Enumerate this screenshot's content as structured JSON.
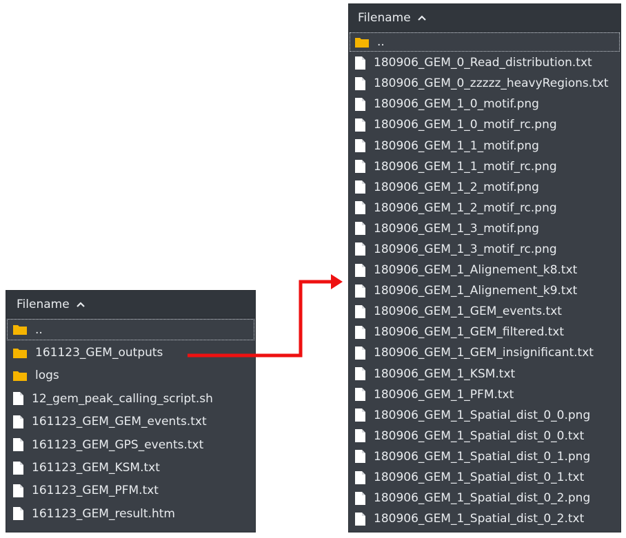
{
  "left_panel": {
    "header": {
      "label": "Filename"
    },
    "rows": [
      {
        "label": "..",
        "kind": "folder",
        "selected": true
      },
      {
        "label": "161123_GEM_outputs",
        "kind": "folder"
      },
      {
        "label": "logs",
        "kind": "folder"
      },
      {
        "label": "12_gem_peak_calling_script.sh",
        "kind": "file"
      },
      {
        "label": "161123_GEM_GEM_events.txt",
        "kind": "file"
      },
      {
        "label": "161123_GEM_GPS_events.txt",
        "kind": "file"
      },
      {
        "label": "161123_GEM_KSM.txt",
        "kind": "file"
      },
      {
        "label": "161123_GEM_PFM.txt",
        "kind": "file"
      },
      {
        "label": "161123_GEM_result.htm",
        "kind": "file"
      }
    ]
  },
  "right_panel": {
    "header": {
      "label": "Filename"
    },
    "rows": [
      {
        "label": "..",
        "kind": "folder",
        "selected": true
      },
      {
        "label": "180906_GEM_0_Read_distribution.txt",
        "kind": "file"
      },
      {
        "label": "180906_GEM_0_zzzzz_heavyRegions.txt",
        "kind": "file"
      },
      {
        "label": "180906_GEM_1_0_motif.png",
        "kind": "file"
      },
      {
        "label": "180906_GEM_1_0_motif_rc.png",
        "kind": "file"
      },
      {
        "label": "180906_GEM_1_1_motif.png",
        "kind": "file"
      },
      {
        "label": "180906_GEM_1_1_motif_rc.png",
        "kind": "file"
      },
      {
        "label": "180906_GEM_1_2_motif.png",
        "kind": "file"
      },
      {
        "label": "180906_GEM_1_2_motif_rc.png",
        "kind": "file"
      },
      {
        "label": "180906_GEM_1_3_motif.png",
        "kind": "file"
      },
      {
        "label": "180906_GEM_1_3_motif_rc.png",
        "kind": "file"
      },
      {
        "label": "180906_GEM_1_Alignement_k8.txt",
        "kind": "file"
      },
      {
        "label": "180906_GEM_1_Alignement_k9.txt",
        "kind": "file"
      },
      {
        "label": "180906_GEM_1_GEM_events.txt",
        "kind": "file"
      },
      {
        "label": "180906_GEM_1_GEM_filtered.txt",
        "kind": "file"
      },
      {
        "label": "180906_GEM_1_GEM_insignificant.txt",
        "kind": "file"
      },
      {
        "label": "180906_GEM_1_KSM.txt",
        "kind": "file"
      },
      {
        "label": "180906_GEM_1_PFM.txt",
        "kind": "file"
      },
      {
        "label": "180906_GEM_1_Spatial_dist_0_0.png",
        "kind": "file"
      },
      {
        "label": "180906_GEM_1_Spatial_dist_0_0.txt",
        "kind": "file"
      },
      {
        "label": "180906_GEM_1_Spatial_dist_0_1.png",
        "kind": "file"
      },
      {
        "label": "180906_GEM_1_Spatial_dist_0_1.txt",
        "kind": "file"
      },
      {
        "label": "180906_GEM_1_Spatial_dist_0_2.png",
        "kind": "file"
      },
      {
        "label": "180906_GEM_1_Spatial_dist_0_2.txt",
        "kind": "file"
      }
    ]
  },
  "colors": {
    "panel_bg": "#3a3f46",
    "header_bg": "#31363c",
    "text": "#e9ecef",
    "folder": "#f5b400",
    "file": "#ffffff",
    "arrow": "#ee1111"
  },
  "icons": {
    "folder": "folder-icon",
    "file": "file-icon",
    "sort": "chevron-up-icon",
    "connector": "arrow-right-icon"
  }
}
